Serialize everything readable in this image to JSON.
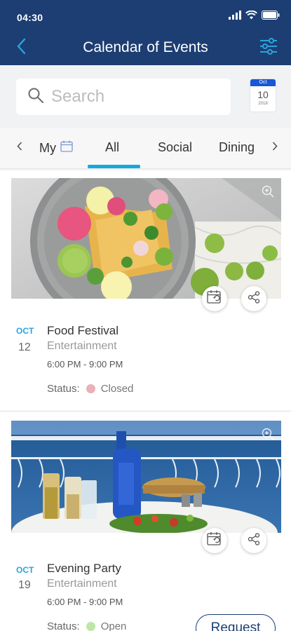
{
  "status_bar": {
    "time": "04:30"
  },
  "header": {
    "title": "Calendar of Events"
  },
  "search": {
    "placeholder": "Search"
  },
  "calendar_badge": {
    "month": "Oct",
    "day": "10",
    "year": "2018"
  },
  "tabs": [
    {
      "label": "My",
      "active": false
    },
    {
      "label": "All",
      "active": true
    },
    {
      "label": "Social",
      "active": false
    },
    {
      "label": "Dining",
      "active": false
    }
  ],
  "events": [
    {
      "month": "OCT",
      "day": "12",
      "title": "Food Festival",
      "category": "Entertainment",
      "time": "6:00 PM - 9:00 PM",
      "status_label": "Status:",
      "status": "Closed",
      "status_color": "#eab1b8"
    },
    {
      "month": "OCT",
      "day": "19",
      "title": "Evening Party",
      "category": "Entertainment",
      "time": "6:00 PM - 9:00 PM",
      "status_label": "Status:",
      "status": "Open",
      "status_color": "#bfe6a8",
      "action_label": "Request"
    }
  ],
  "colors": {
    "header_bg": "#1d3e73",
    "accent": "#15a8df",
    "date_accent": "#29a6dd"
  }
}
